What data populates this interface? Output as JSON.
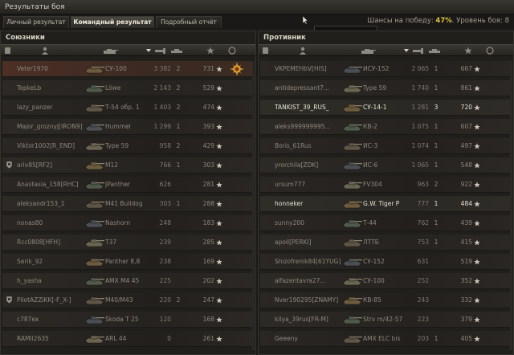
{
  "window": {
    "title": "Результаты боя"
  },
  "tabs": [
    {
      "label": "Личный результат"
    },
    {
      "label": "Командный результат"
    },
    {
      "label": "Подробный отчёт"
    }
  ],
  "tooltip": {
    "text": "Результаты боя"
  },
  "chance": {
    "prefix": "Шансы на победу:",
    "value": "47%",
    "suffix": ". Уровень боя: 8"
  },
  "allies": {
    "title": "Союзники",
    "rows": [
      {
        "name": "Veter1970",
        "tank": "СУ-100",
        "dmg": "3 382",
        "frags": "2",
        "xp": "731",
        "state": "dead",
        "highlight": true,
        "medal": true
      },
      {
        "name": "TopkeLb",
        "tank": "Löwe",
        "dmg": "2 143",
        "frags": "2",
        "xp": "529",
        "state": "dead"
      },
      {
        "name": "lazy_panzer",
        "tank": "Т-54 обр. 1",
        "dmg": "1 403",
        "frags": "2",
        "xp": "474",
        "state": "dead"
      },
      {
        "name": "Major_groznyj[IRON9]",
        "tank": "Hummel",
        "dmg": "1 299",
        "frags": "1",
        "xp": "393",
        "state": "dead"
      },
      {
        "name": "Viktor1002[R_END]",
        "tank": "Type 59",
        "dmg": "958",
        "frags": "2",
        "xp": "429",
        "state": "dead"
      },
      {
        "name": "ariv85[RF2]",
        "tank": "M12",
        "dmg": "766",
        "frags": "1",
        "xp": "303",
        "state": "dead",
        "squad": true
      },
      {
        "name": "Anastasia_158[RHC]",
        "tank": "JPanther",
        "dmg": "626",
        "frags": "",
        "xp": "281",
        "state": "dead"
      },
      {
        "name": "aleksandr153_1",
        "tank": "M41 Bulldog",
        "dmg": "303",
        "frags": "1",
        "xp": "288",
        "state": "dead"
      },
      {
        "name": "nonas80",
        "tank": "Nashorn",
        "dmg": "248",
        "frags": "",
        "xp": "183",
        "state": "dead"
      },
      {
        "name": "Rcc0808[HFH]",
        "tank": "T37",
        "dmg": "239",
        "frags": "",
        "xp": "285",
        "state": "dead"
      },
      {
        "name": "Serik_92",
        "tank": "Panther 8,8",
        "dmg": "238",
        "frags": "",
        "xp": "169",
        "state": "dead"
      },
      {
        "name": "h_yasha",
        "tank": "AMX M4 45",
        "dmg": "225",
        "frags": "",
        "xp": "202",
        "state": "dead"
      },
      {
        "name": "PilotAZZiKK[-F_X-]",
        "tank": "M40/M43",
        "dmg": "220",
        "frags": "2",
        "xp": "247",
        "state": "dead",
        "squad": true
      },
      {
        "name": "c787ex",
        "tank": "Škoda T 25",
        "dmg": "120",
        "frags": "",
        "xp": "168",
        "state": "dead"
      },
      {
        "name": "RAMil2635",
        "tank": "ARL 44",
        "dmg": "0",
        "frags": "",
        "xp": "261",
        "state": "dead"
      }
    ]
  },
  "enemies": {
    "title": "Противник",
    "rows": [
      {
        "name": "VKPEMEHbV[HIS]",
        "tank": "ИСУ-152",
        "dmg": "2 065",
        "frags": "1",
        "xp": "667",
        "state": "dead"
      },
      {
        "name": "antidepressant7...",
        "tank": "Type 59",
        "dmg": "1 740",
        "frags": "1",
        "xp": "861",
        "state": "dead"
      },
      {
        "name": "TANKIST_39_RUS_",
        "tank": "СУ-14-1",
        "dmg": "1 281",
        "frags": "3",
        "xp": "720",
        "state": "alive"
      },
      {
        "name": "aleks999999995...",
        "tank": "КВ-2",
        "dmg": "1 075",
        "frags": "1",
        "xp": "607",
        "state": "dead"
      },
      {
        "name": "Boris_61Rus",
        "tank": "ИС-3",
        "dmg": "1 074",
        "frags": "1",
        "xp": "497",
        "state": "dead"
      },
      {
        "name": "yrorchila[ZDK]",
        "tank": "ИС-6",
        "dmg": "1 065",
        "frags": "1",
        "xp": "548",
        "state": "dead"
      },
      {
        "name": "ursum777",
        "tank": "FV304",
        "dmg": "963",
        "frags": "2",
        "xp": "922",
        "state": "dead"
      },
      {
        "name": "honneker",
        "tank": "G.W. Tiger P",
        "dmg": "777",
        "frags": "1",
        "xp": "484",
        "state": "alive"
      },
      {
        "name": "sunny200",
        "tank": "Т-44",
        "dmg": "762",
        "frags": "1",
        "xp": "439",
        "state": "dead"
      },
      {
        "name": "apoll[PERKI]",
        "tank": "ЛТТБ",
        "dmg": "753",
        "frags": "1",
        "xp": "415",
        "state": "dead"
      },
      {
        "name": "Shizofrenik84[61YUG]",
        "tank": "СУ-152",
        "dmg": "631",
        "frags": "",
        "xp": "519",
        "state": "dead"
      },
      {
        "name": "alfazentavra27...",
        "tank": "СУ-100",
        "dmg": "252",
        "frags": "",
        "xp": "352",
        "state": "dead"
      },
      {
        "name": "Nver190295[ZNAMY]",
        "tank": "КВ-85",
        "dmg": "243",
        "frags": "",
        "xp": "332",
        "state": "dead"
      },
      {
        "name": "kilya_39rus[FR-M]",
        "tank": "Strv m/42-57",
        "dmg": "223",
        "frags": "",
        "xp": "379",
        "state": "dead"
      },
      {
        "name": "Geeeny",
        "tank": "AMX ELC bis",
        "dmg": "203",
        "frags": "1",
        "xp": "405",
        "state": "dead"
      }
    ]
  },
  "colors": {
    "accent": "#d9c53a",
    "highlight_row": "#4c2f25",
    "star": "#c9c4b6"
  },
  "icons": {
    "column_icons": [
      "squad-icon",
      "player-icon",
      "tank-icon",
      "sort-icon",
      "damage-icon",
      "frags-icon",
      "xp-icon",
      "achievements-icon"
    ]
  }
}
